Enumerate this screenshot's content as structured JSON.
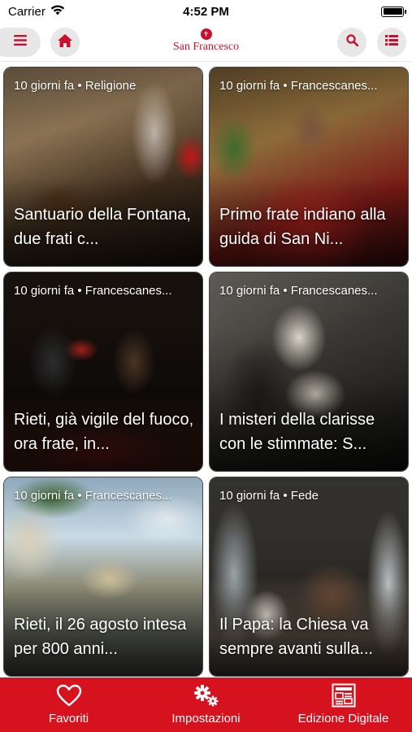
{
  "status": {
    "carrier": "Carrier",
    "time": "4:52 PM"
  },
  "header": {
    "logo_text": "San Francesco",
    "brand_color": "#c8102e"
  },
  "cards": [
    {
      "meta": "10 giorni fa • Religione",
      "title": "Santuario della Fontana, due frati c..."
    },
    {
      "meta": "10 giorni fa • Francescanes...",
      "title": "Primo frate indiano alla guida di San Ni..."
    },
    {
      "meta": "10 giorni fa • Francescanes...",
      "title": "Rieti, già vigile del fuoco, ora frate, in..."
    },
    {
      "meta": "10 giorni fa • Francescanes...",
      "title": "I misteri della clarisse con le stimmate: S..."
    },
    {
      "meta": "10 giorni fa • Francescanes...",
      "title": "Rieti, il 26 agosto intesa per 800 anni..."
    },
    {
      "meta": "10 giorni fa • Fede",
      "title": "Il Papa: la Chiesa va sempre avanti sulla..."
    }
  ],
  "tabbar": {
    "color": "#d7121f",
    "tabs": [
      {
        "label": "Favoriti",
        "icon": "heart-icon"
      },
      {
        "label": "Impostazioni",
        "icon": "gears-icon"
      },
      {
        "label": "Edizione Digitale",
        "icon": "newspaper-icon"
      }
    ]
  }
}
